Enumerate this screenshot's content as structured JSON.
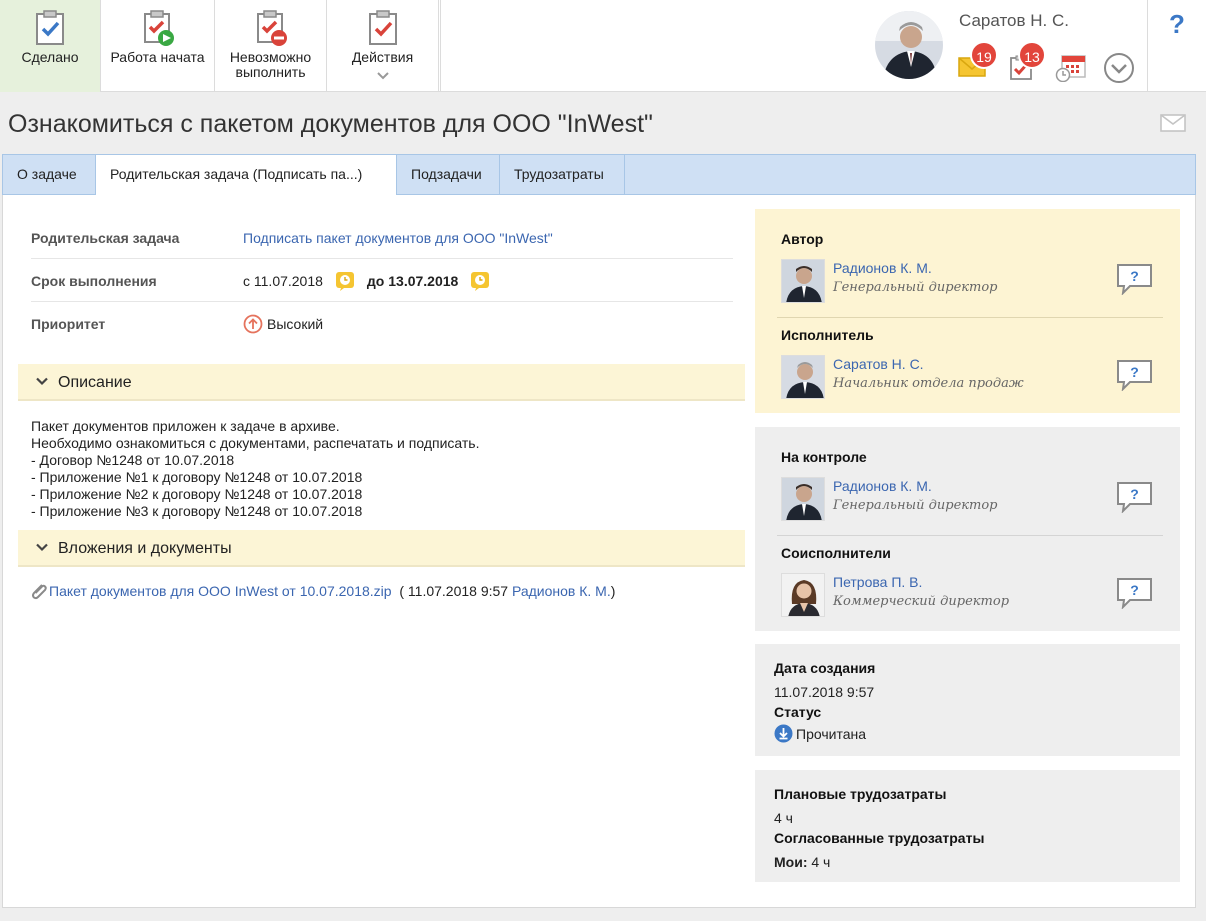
{
  "toolbar": {
    "done_label": "Сделано",
    "start_label": "Работа начата",
    "impossible_label_1": "Невозможно",
    "impossible_label_2": "выполнить",
    "actions_label": "Действия"
  },
  "user": {
    "name": "Саратов Н. С.",
    "mail_count": "19",
    "tasks_count": "13"
  },
  "help_label": "?",
  "page_title": "Ознакомиться с пакетом документов для ООО \"InWest\"",
  "tabs": [
    {
      "label": "О задаче"
    },
    {
      "label": "Родительская задача (Подписать па...)"
    },
    {
      "label": "Подзадачи"
    },
    {
      "label": "Трудозатраты"
    }
  ],
  "fields": {
    "parent_label": "Родительская задача",
    "parent_value": "Подписать пакет документов для ООО \"InWest\"",
    "deadline_label": "Срок выполнения",
    "deadline_from": "с 11.07.2018",
    "deadline_to": "до 13.07.2018",
    "priority_label": "Приоритет",
    "priority_value": "Высокий"
  },
  "description": {
    "title": "Описание",
    "lines": [
      "Пакет документов приложен к задаче в архиве.",
      "Необходимо ознакомиться с документами, распечатать и подписать.",
      "- Договор №1248 от 10.07.2018",
      "- Приложение №1 к договору №1248 от 10.07.2018",
      "- Приложение №2 к договору №1248 от 10.07.2018",
      "- Приложение №3 к договору №1248 от 10.07.2018"
    ]
  },
  "attachments": {
    "title": "Вложения и документы",
    "file_name": "Пакет документов для ООО InWest от 10.07.2018.zip",
    "open_paren": "(",
    "date": "11.07.2018 9:57",
    "author": "Радионов К. М.",
    "close_paren": ")"
  },
  "people": {
    "author_header": "Автор",
    "author": {
      "name": "Радионов К. М.",
      "role": "Генеральный директор"
    },
    "executor_header": "Исполнитель",
    "executor": {
      "name": "Саратов Н. С.",
      "role": "Начальник отдела продаж"
    },
    "control_header": "На контроле",
    "control": {
      "name": "Радионов К. М.",
      "role": "Генеральный директор"
    },
    "coexec_header": "Соисполнители",
    "coexec": {
      "name": "Петрова П. В.",
      "role": "Коммерческий директор"
    }
  },
  "info": {
    "created_label": "Дата создания",
    "created_value": "11.07.2018 9:57",
    "status_label": "Статус",
    "status_value": "Прочитана"
  },
  "effort": {
    "planned_label": "Плановые трудозатраты",
    "planned_value": "4 ч",
    "agreed_label": "Согласованные трудозатраты",
    "mine_label": "Мои:",
    "mine_value": "4 ч"
  },
  "colors": {
    "accent_blue": "#3b66b0",
    "badge_red": "#e2453b",
    "tab_bar": "#cfe0f4",
    "yellow_card": "#fdf4d3"
  }
}
